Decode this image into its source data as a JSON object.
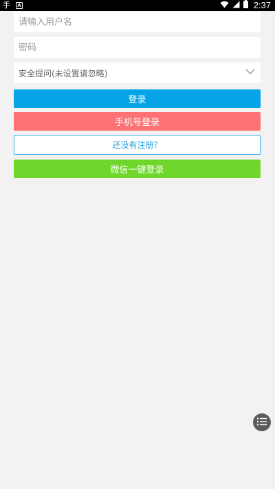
{
  "status_bar": {
    "left_glyph": "手",
    "left_box": "A",
    "time": "2:37"
  },
  "form": {
    "username_placeholder": "请输入用户名",
    "password_placeholder": "密码",
    "security_question": "安全提问(未设置请忽略)"
  },
  "buttons": {
    "login": "登录",
    "phone_login": "手机号登录",
    "register": "还没有注册？",
    "wechat_login": "微信一键登录"
  },
  "colors": {
    "login": "#05a4e7",
    "phone_login": "#fd7274",
    "register_border": "#31a9e5",
    "wechat_login": "#6fd62c",
    "background": "#f2f2f2"
  },
  "icons": {
    "wifi": "wifi-icon",
    "signal": "signal-icon",
    "battery": "battery-icon",
    "chevron": "chevron-down-icon",
    "menu": "list-menu-icon"
  }
}
